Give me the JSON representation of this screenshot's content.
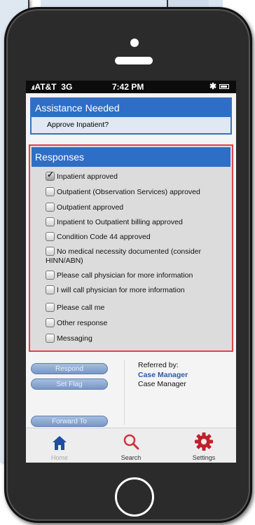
{
  "status_bar": {
    "carrier": "AT&T",
    "network": "3G",
    "time": "7:42 PM"
  },
  "assistance": {
    "title": "Assistance Needed",
    "question": "Approve Inpatient?"
  },
  "responses": {
    "title": "Responses",
    "options": [
      {
        "label": "Inpatient approved",
        "checked": true
      },
      {
        "label": "Outpatient (Observation Services) approved",
        "checked": false
      },
      {
        "label": "Outpatient approved",
        "checked": false
      },
      {
        "label": "Inpatient to Outpatient billing approved",
        "checked": false
      },
      {
        "label": "Condition Code 44 approved",
        "checked": false
      },
      {
        "label": "No medical necessity documented (consider HINN/ABN)",
        "checked": false
      },
      {
        "label": "Please call physician for more information",
        "checked": false
      },
      {
        "label": "I will call physician for more information",
        "checked": false
      },
      {
        "label": "Please call me",
        "checked": false
      },
      {
        "label": "Other response",
        "checked": false
      },
      {
        "label": "Messaging",
        "checked": false
      }
    ]
  },
  "actions": {
    "respond": "Respond",
    "set_flag": "Set Flag",
    "forward_to": "Forward To"
  },
  "referral": {
    "label": "Referred by:",
    "name": "Case Manager",
    "role": "Case Manager"
  },
  "tabs": {
    "home": "Home",
    "search": "Search",
    "settings": "Settings"
  },
  "colors": {
    "accent_blue": "#2e6ec6",
    "responses_border": "#e0434b",
    "settings_red": "#c0202a"
  }
}
